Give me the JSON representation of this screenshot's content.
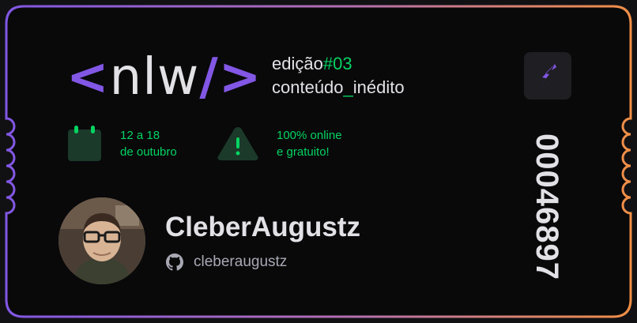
{
  "brand": {
    "logo_open": "<",
    "logo_text_a": "nl",
    "logo_text_b": "w",
    "logo_slash": "/",
    "logo_close": ">"
  },
  "edition": {
    "label": "edição",
    "number": "#03",
    "tag_a": "conteúdo",
    "tag_b": "_",
    "tag_c": "inédito"
  },
  "info": {
    "dates_line1": "12 a 18",
    "dates_line2": "de outubro",
    "access_line1": "100% online",
    "access_line2": "e gratuito!"
  },
  "user": {
    "name": "CleberAugustz",
    "handle": "cleberaugustz"
  },
  "ticket": {
    "number": "00046897"
  },
  "colors": {
    "accent_purple": "#8257E5",
    "accent_green": "#04D361",
    "border_orange": "#F18F46",
    "text_main": "#E1E1E6",
    "text_muted": "#A8A8B3",
    "card_bg": "#09090A"
  },
  "icons": {
    "calendar": "calendar-icon",
    "alert": "alert-triangle-icon",
    "github": "github-icon",
    "bolt": "lightning-bolt-icon"
  }
}
